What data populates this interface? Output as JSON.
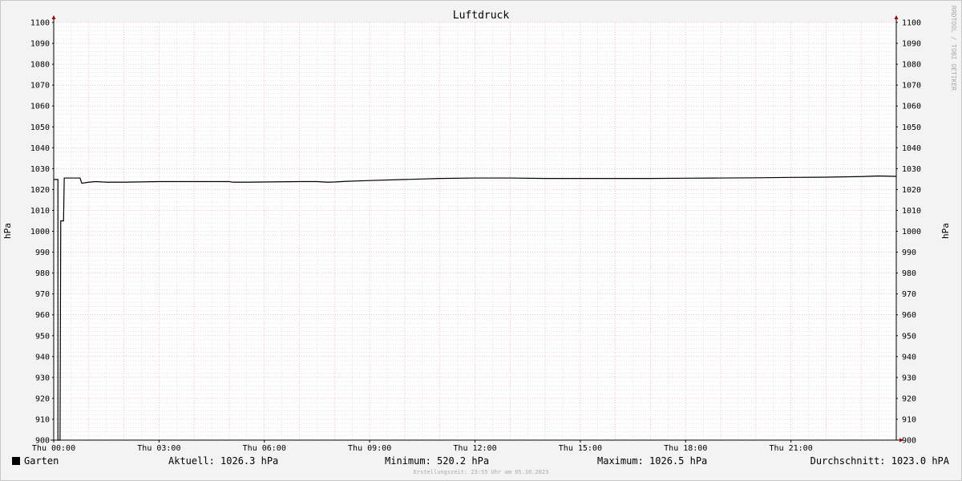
{
  "chart_data": {
    "type": "line",
    "title": "Luftdruck",
    "ylabel": "hPa",
    "ylabel_right": "hPa",
    "ylim": [
      900,
      1100
    ],
    "y_major_ticks": [
      "900",
      "910",
      "920",
      "930",
      "940",
      "950",
      "960",
      "970",
      "980",
      "990",
      "1000",
      "1010",
      "1020",
      "1030",
      "1040",
      "1050",
      "1060",
      "1070",
      "1080",
      "1090",
      "1100"
    ],
    "xlim_hours": [
      0,
      24
    ],
    "x_tick_labels": [
      "Thu 00:00",
      "Thu 03:00",
      "Thu 06:00",
      "Thu 09:00",
      "Thu 12:00",
      "Thu 15:00",
      "Thu 18:00",
      "Thu 21:00"
    ],
    "grid": true,
    "watermark": "RRDTOOL / TOBI OETIKER",
    "series": [
      {
        "name": "Garten",
        "color": "#000000",
        "points": [
          [
            0.0,
            1024.8
          ],
          [
            0.12,
            1024.8
          ],
          [
            0.12,
            520.2
          ],
          [
            0.18,
            520.2
          ],
          [
            0.2,
            1005.0
          ],
          [
            0.28,
            1005.0
          ],
          [
            0.3,
            1025.5
          ],
          [
            0.75,
            1025.5
          ],
          [
            0.8,
            1023.0
          ],
          [
            1.0,
            1023.5
          ],
          [
            1.2,
            1023.8
          ],
          [
            1.5,
            1023.5
          ],
          [
            2.0,
            1023.5
          ],
          [
            3.0,
            1023.8
          ],
          [
            4.0,
            1023.8
          ],
          [
            5.0,
            1023.8
          ],
          [
            5.1,
            1023.5
          ],
          [
            5.5,
            1023.5
          ],
          [
            6.0,
            1023.6
          ],
          [
            6.5,
            1023.7
          ],
          [
            7.0,
            1023.8
          ],
          [
            7.5,
            1023.8
          ],
          [
            7.8,
            1023.5
          ],
          [
            8.0,
            1023.6
          ],
          [
            8.3,
            1023.9
          ],
          [
            9.0,
            1024.3
          ],
          [
            10.0,
            1024.8
          ],
          [
            11.0,
            1025.3
          ],
          [
            12.0,
            1025.5
          ],
          [
            13.0,
            1025.5
          ],
          [
            14.0,
            1025.3
          ],
          [
            15.0,
            1025.3
          ],
          [
            16.0,
            1025.3
          ],
          [
            17.0,
            1025.3
          ],
          [
            18.0,
            1025.4
          ],
          [
            19.0,
            1025.5
          ],
          [
            20.0,
            1025.6
          ],
          [
            21.0,
            1025.8
          ],
          [
            22.0,
            1025.9
          ],
          [
            23.0,
            1026.2
          ],
          [
            23.5,
            1026.5
          ],
          [
            24.0,
            1026.3
          ]
        ]
      }
    ]
  },
  "legend": {
    "series_label": "Garten",
    "current": "Aktuell: 1026.3 hPa",
    "minimum": "Minimum: 520.2 hPa",
    "maximum": "Maximum: 1026.5 hPa",
    "average": "Durchschnitt: 1023.0 hPA"
  },
  "footer": "Erstellungszeit: 23:55 Uhr am 05.10.2023",
  "colors": {
    "major_grid": "#e8a0a0",
    "minor_grid": "#c8c8c8",
    "axis": "#000000",
    "arrow": "#990000",
    "plot_bg": "#ffffff"
  }
}
